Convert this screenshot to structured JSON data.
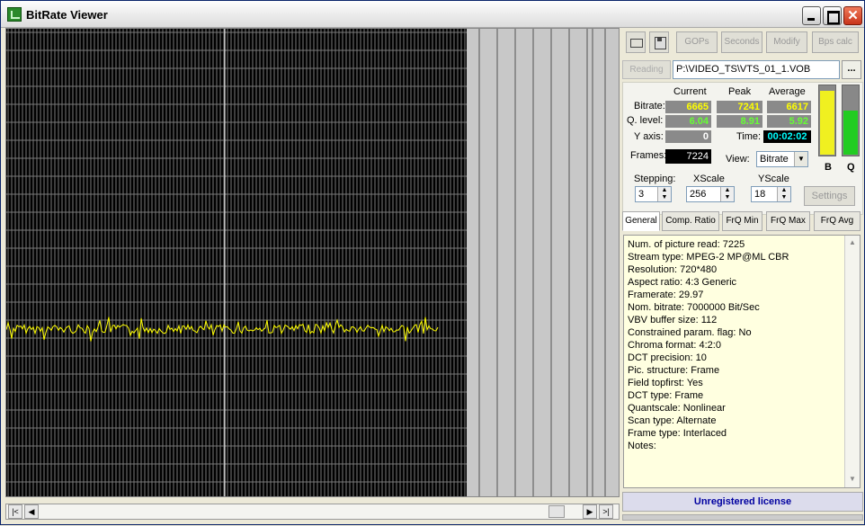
{
  "window": {
    "title": "BitRate Viewer"
  },
  "titlebar": {
    "minimize_icon": "minimize-icon",
    "maximize_icon": "maximize-icon",
    "close_glyph": "✕"
  },
  "toolbar": {
    "gops": "GOPs",
    "seconds": "Seconds",
    "modify": "Modify",
    "bps_calc": "Bps calc"
  },
  "file": {
    "status": "Reading",
    "path": "P:\\VIDEO_TS\\VTS_01_1.VOB",
    "browse": "..."
  },
  "stats": {
    "col_current": "Current",
    "col_peak": "Peak",
    "col_average": "Average",
    "bitrate_label": "Bitrate:",
    "bitrate_current": "6665",
    "bitrate_peak": "7241",
    "bitrate_average": "6617",
    "qlevel_label": "Q. level:",
    "qlevel_current": "6.04",
    "qlevel_peak": "8.91",
    "qlevel_average": "5.92",
    "yaxis_label": "Y axis:",
    "yaxis_value": "0",
    "time_label": "Time:",
    "time_value": "00:02:02",
    "frames_label": "Frames:",
    "frames_value": "7224",
    "view_label": "View:",
    "view_value": "Bitrate",
    "meter_b_label": "B",
    "meter_q_label": "Q",
    "meter_b_level": 0.94,
    "meter_q_level": 0.65
  },
  "controls": {
    "stepping_label": "Stepping:",
    "stepping_value": "3",
    "xscale_label": "XScale",
    "xscale_value": "256",
    "yscale_label": "YScale",
    "yscale_value": "18",
    "settings": "Settings"
  },
  "tabs": [
    "General",
    "Comp. Ratio",
    "FrQ Min",
    "FrQ Max",
    "FrQ Avg"
  ],
  "info": [
    "Num. of picture read: 7225",
    "Stream type: MPEG-2  MP@ML  CBR",
    "Resolution: 720*480",
    "Aspect ratio: 4:3 Generic",
    "Framerate: 29.97",
    "Nom. bitrate: 7000000 Bit/Sec",
    "VBV buffer size: 112",
    "Constrained param. flag: No",
    "Chroma format: 4:2:0",
    "DCT precision: 10",
    "Pic. structure: Frame",
    "Field topfirst: Yes",
    "DCT type: Frame",
    "Quantscale: Nonlinear",
    "Scan type: Alternate",
    "Frame type: Interlaced",
    "Notes:"
  ],
  "license": "Unregistered license",
  "colors": {
    "trace": "#ffff00",
    "grid": "#7a7a7a",
    "background": "#000000"
  }
}
